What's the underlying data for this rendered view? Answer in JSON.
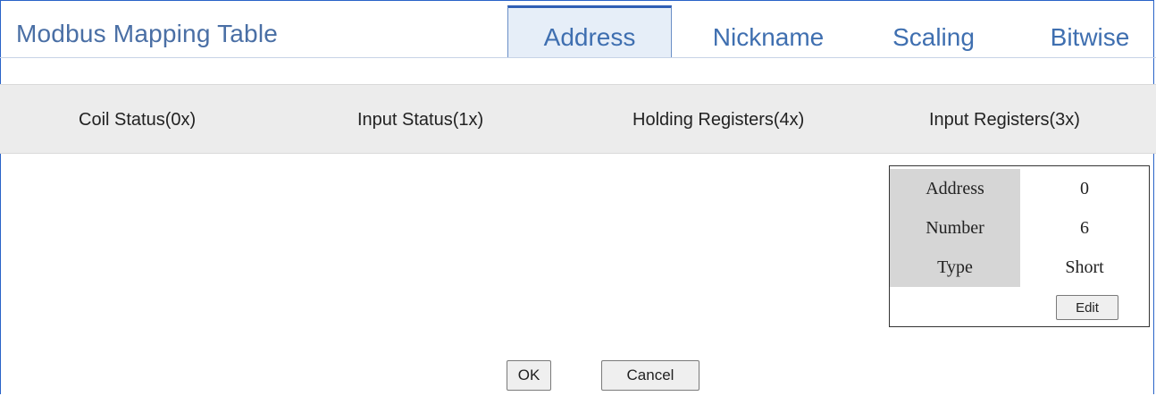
{
  "app": {
    "title": "Modbus Mapping Table"
  },
  "tabs": [
    {
      "label": "Address",
      "active": true
    },
    {
      "label": "Nickname",
      "active": false
    },
    {
      "label": "Scaling",
      "active": false
    },
    {
      "label": "Bitwise",
      "active": false
    }
  ],
  "subtabs": [
    {
      "label": "Coil Status(0x)"
    },
    {
      "label": "Input Status(1x)"
    },
    {
      "label": "Holding Registers(4x)"
    },
    {
      "label": "Input Registers(3x)"
    }
  ],
  "mapping": {
    "rows": [
      {
        "label": "Address",
        "value": "0"
      },
      {
        "label": "Number",
        "value": "6"
      },
      {
        "label": "Type",
        "value": "Short"
      }
    ],
    "edit_label": "Edit"
  },
  "footer": {
    "ok_label": "OK",
    "cancel_label": "Cancel"
  },
  "colors": {
    "accent": "#2f5fb5",
    "title": "#4a6fa5",
    "subtab_bg": "#ececec",
    "label_cell": "#d6d6d6"
  }
}
